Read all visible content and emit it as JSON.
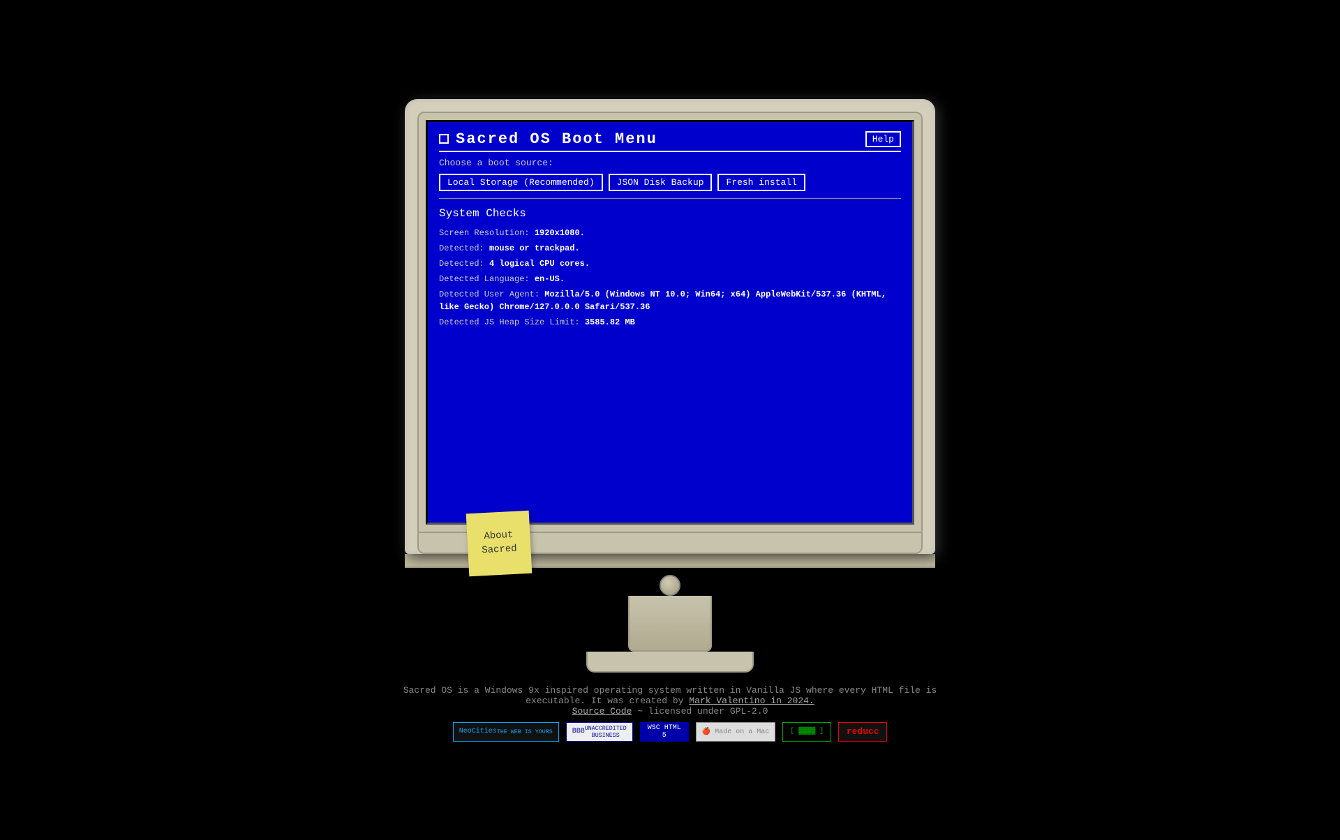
{
  "page": {
    "background": "#000000"
  },
  "monitor": {
    "screen_bg": "#0000cc"
  },
  "title_bar": {
    "title": "Sacred OS Boot Menu",
    "help_button": "Help",
    "checkbox_label": "window-checkbox"
  },
  "boot_section": {
    "label": "Choose a boot source:",
    "buttons": [
      {
        "label": "Local Storage (Recommended)",
        "id": "local-storage"
      },
      {
        "label": "JSON Disk Backup",
        "id": "json-disk"
      },
      {
        "label": "Fresh install",
        "id": "fresh-install"
      }
    ]
  },
  "system_checks": {
    "heading": "System Checks",
    "lines": [
      {
        "prefix": "Screen Resolution: ",
        "value": "1920x1080."
      },
      {
        "prefix": "Detected: ",
        "value": "mouse or trackpad."
      },
      {
        "prefix": "Detected: ",
        "value": "4 logical CPU cores."
      },
      {
        "prefix": "Detected Language: ",
        "value": "en-US."
      },
      {
        "prefix": "Detected User Agent: ",
        "value": "Mozilla/5.0 (Windows NT 10.0; Win64; x64) AppleWebKit/537.36 (KHTML, like Gecko) Chrome/127.0.0.0 Safari/537.36"
      },
      {
        "prefix": "Detected JS Heap Size Limit: ",
        "value": "3585.82 MB"
      }
    ]
  },
  "sticky_note": {
    "text": "About\nSacred"
  },
  "footer": {
    "description": "Sacred OS is a Windows 9x inspired operating system written in Vanilla JS where every HTML file is",
    "description2": "executable. It was created by",
    "author_link": "Mark Valentino in 2024.",
    "source_label": "Source Code",
    "license": "~ licensed under GPL-2.0"
  },
  "badges": [
    {
      "label": "NeoCities\nTHE WEB IS YOURS",
      "class": "neocities"
    },
    {
      "label": "BBB\nUNACCREDITED\nBUSINESS",
      "class": "bbb"
    },
    {
      "label": "WSC HTML\n5",
      "class": "w3c"
    },
    {
      "label": "Made on a\nMac",
      "class": "mac"
    },
    {
      "label": "[ ▓▓▓▓▓▓ ]",
      "class": "github"
    },
    {
      "label": "reducc",
      "class": "reducc"
    }
  ]
}
